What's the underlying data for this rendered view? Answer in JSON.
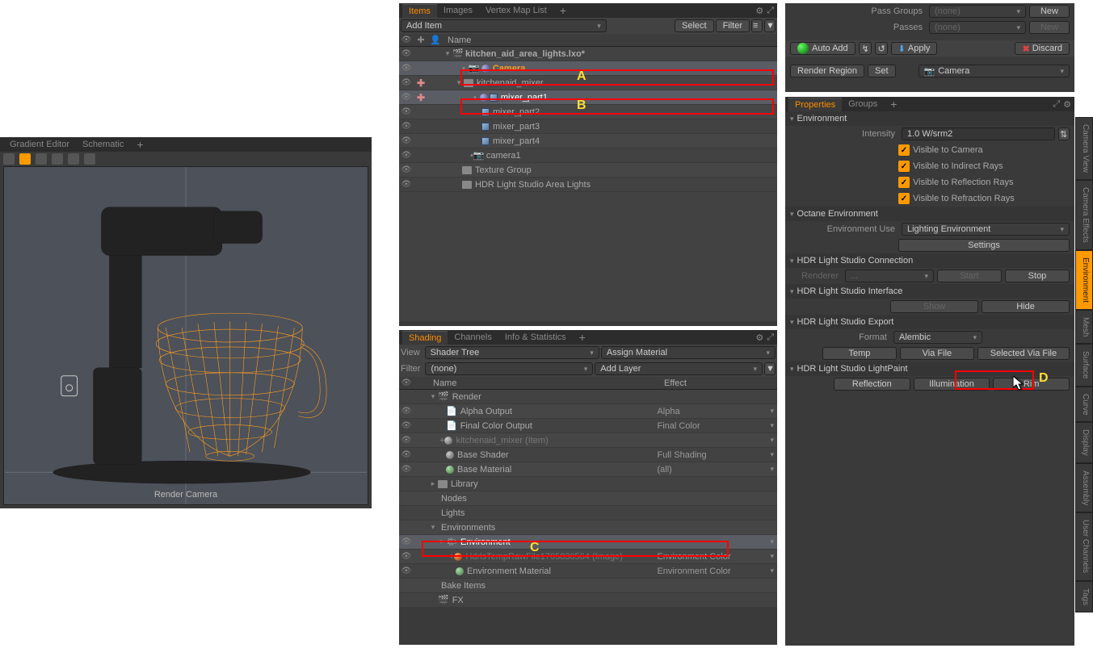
{
  "left_panel": {
    "tabs": [
      "Gradient Editor",
      "Schematic"
    ],
    "vp_label": "Render Camera"
  },
  "items_panel": {
    "tabs": [
      "Items",
      "Images",
      "Vertex Map List"
    ],
    "active_tab": "Items",
    "add_btn": "Add Item",
    "select_btn": "Select",
    "filter_btn": "Filter",
    "name_col": "Name",
    "rows": [
      {
        "name": "kitchen_aid_area_lights.lxo*",
        "bold": true,
        "indent": 0
      },
      {
        "name": "Camera",
        "indent": 1,
        "sel": true,
        "orange": true
      },
      {
        "name": "kitchenaid_mixer",
        "indent": 1
      },
      {
        "name": "mixer_part1",
        "indent": 2,
        "sel": true
      },
      {
        "name": "mixer_part2",
        "indent": 2
      },
      {
        "name": "mixer_part3",
        "indent": 2
      },
      {
        "name": "mixer_part4",
        "indent": 2
      },
      {
        "name": "camera1",
        "indent": 1
      },
      {
        "name": "Texture Group",
        "indent": 1
      },
      {
        "name": "HDR Light Studio Area Lights",
        "indent": 1
      }
    ]
  },
  "shading_panel": {
    "tabs": [
      "Shading",
      "Channels",
      "Info & Statistics"
    ],
    "active_tab": "Shading",
    "view_label": "View",
    "view_value": "Shader Tree",
    "assign_btn": "Assign Material",
    "filter_label": "Filter",
    "filter_value": "(none)",
    "add_layer": "Add Layer",
    "cols": {
      "name": "Name",
      "effect": "Effect"
    },
    "rows": [
      {
        "name": "Render",
        "indent": 0,
        "effect": ""
      },
      {
        "name": "Alpha Output",
        "indent": 1,
        "effect": "Alpha"
      },
      {
        "name": "Final Color Output",
        "indent": 1,
        "effect": "Final Color"
      },
      {
        "name": "kitchenaid_mixer (Item)",
        "indent": 1,
        "effect": "",
        "dim": true
      },
      {
        "name": "Base Shader",
        "indent": 1,
        "effect": "Full Shading"
      },
      {
        "name": "Base Material",
        "indent": 1,
        "effect": "(all)"
      },
      {
        "name": "Library",
        "indent": 0,
        "effect": ""
      },
      {
        "name": "Nodes",
        "indent": 0,
        "effect": ""
      },
      {
        "name": "Lights",
        "indent": 0,
        "effect": ""
      },
      {
        "name": "Environments",
        "indent": 0,
        "effect": ""
      },
      {
        "name": "Environment",
        "indent": 1,
        "effect": "",
        "sel": true
      },
      {
        "name": "HdrlsTempRawFile1705830564 (Image)",
        "indent": 2,
        "effect": "Environment Color",
        "dim": true
      },
      {
        "name": "Environment Material",
        "indent": 2,
        "effect": "Environment Color"
      },
      {
        "name": "Bake Items",
        "indent": 0,
        "effect": ""
      },
      {
        "name": "FX",
        "indent": 0,
        "effect": ""
      }
    ]
  },
  "top_right": {
    "pass_groups": "Pass Groups",
    "passes": "Passes",
    "none": "(none)",
    "new_btn": "New",
    "auto_add": "Auto Add",
    "apply": "Apply",
    "discard": "Discard",
    "render_region": "Render Region",
    "set_btn": "Set",
    "camera": "Camera"
  },
  "props": {
    "tabs": [
      "Properties",
      "Groups"
    ],
    "env_head": "Environment",
    "intensity_label": "Intensity",
    "intensity_val": "1.0 W/srm2",
    "vis_camera": "Visible to Camera",
    "vis_indirect": "Visible to Indirect Rays",
    "vis_reflection": "Visible to Reflection Rays",
    "vis_refraction": "Visible to Refraction Rays",
    "octane_head": "Octane Environment",
    "env_use_label": "Environment Use",
    "env_use_val": "Lighting Environment",
    "settings_btn": "Settings",
    "hdrls_conn": "HDR Light Studio Connection",
    "renderer": "Renderer",
    "renderer_val": "...",
    "start_btn": "Start",
    "stop_btn": "Stop",
    "hdrls_iface": "HDR Light Studio Interface",
    "show_btn": "Show",
    "hide_btn": "Hide",
    "hdrls_export": "HDR Light Studio Export",
    "format_label": "Format",
    "format_val": "Alembic",
    "temp_btn": "Temp",
    "via_file": "Via File",
    "sel_via_file": "Selected Via File",
    "lightpaint": "HDR Light Studio LightPaint",
    "reflection": "Reflection",
    "illumination": "Illumination",
    "rim": "Rim"
  },
  "side_tabs": [
    "Camera View",
    "Camera Effects",
    "Environment",
    "Mesh",
    "Surface",
    "Curve",
    "Display",
    "Assembly",
    "User Channels",
    "Tags"
  ],
  "letters": {
    "A": "A",
    "B": "B",
    "C": "C",
    "D": "D"
  }
}
